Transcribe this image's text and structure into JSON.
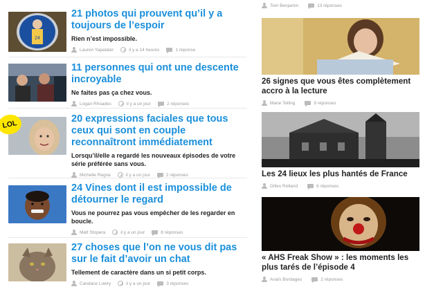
{
  "feed": {
    "articles": [
      {
        "title": "21 photos qui prouvent qu’il y a toujours de l’espoir",
        "subtitle": "Rien n’est impossible.",
        "author": "Lauren Yapalater",
        "time": "il y a 14 heures",
        "comments": "1 réponse",
        "icons": [
          "user-icon",
          "clock-icon",
          "comment-icon"
        ]
      },
      {
        "title": "11 personnes qui ont une descente incroyable",
        "subtitle": "Ne faites pas ça chez vous.",
        "author": "Logan Rhoades",
        "time": "il y a un jour",
        "comments": "2 réponses",
        "icons": [
          "user-icon",
          "clock-icon",
          "comment-icon"
        ]
      },
      {
        "title": "20 expressions faciales que tous ceux qui sont en couple reconnaîtront immédiatement",
        "subtitle": "Lorsqu’il/elle a regardé les nouveaux épisodes de votre série préférée sans vous.",
        "author": "Michelle Regna",
        "time": "il y a un jour",
        "comments": "2 réponses",
        "badge": "LOL",
        "icons": [
          "user-icon",
          "clock-icon",
          "comment-icon"
        ]
      },
      {
        "title": "24 Vines dont il est impossible de détourner le regard",
        "subtitle": "Vous ne pourrez pas vous empêcher de les regarder en boucle.",
        "author": "Matt Stopera",
        "time": "il y a un jour",
        "comments": "8 réponses",
        "icons": [
          "user-icon",
          "clock-icon",
          "comment-icon"
        ]
      },
      {
        "title": "27 choses que l’on ne vous dit pas sur le fait d’avoir un chat",
        "subtitle": "Tellement de caractère dans un si petit corps.",
        "author": "Candace Lowry",
        "time": "il y a un jour",
        "comments": "3 réponses",
        "icons": [
          "user-icon",
          "clock-icon",
          "comment-icon"
        ]
      }
    ]
  },
  "sidebar": {
    "top_meta": {
      "author": "Tom Benjamin",
      "comments": "13 réponses"
    },
    "items": [
      {
        "title": "26 signes que vous êtes complètement accro à la lecture",
        "author": "Marie Telling",
        "comments": "9 réponses"
      },
      {
        "title": "Les 24 lieux les plus hantés de France",
        "author": "Gilles Rolland",
        "comments": "6 réponses"
      },
      {
        "title": "« AHS Freak Show » : les moments les plus tarés de l’épisode 4",
        "author": "Anaïs Bordages",
        "comments": "2 réponses"
      }
    ]
  },
  "colors": {
    "link_blue": "#1a8fdb",
    "meta_gray": "#999999",
    "badge_yellow": "#ffe600"
  }
}
